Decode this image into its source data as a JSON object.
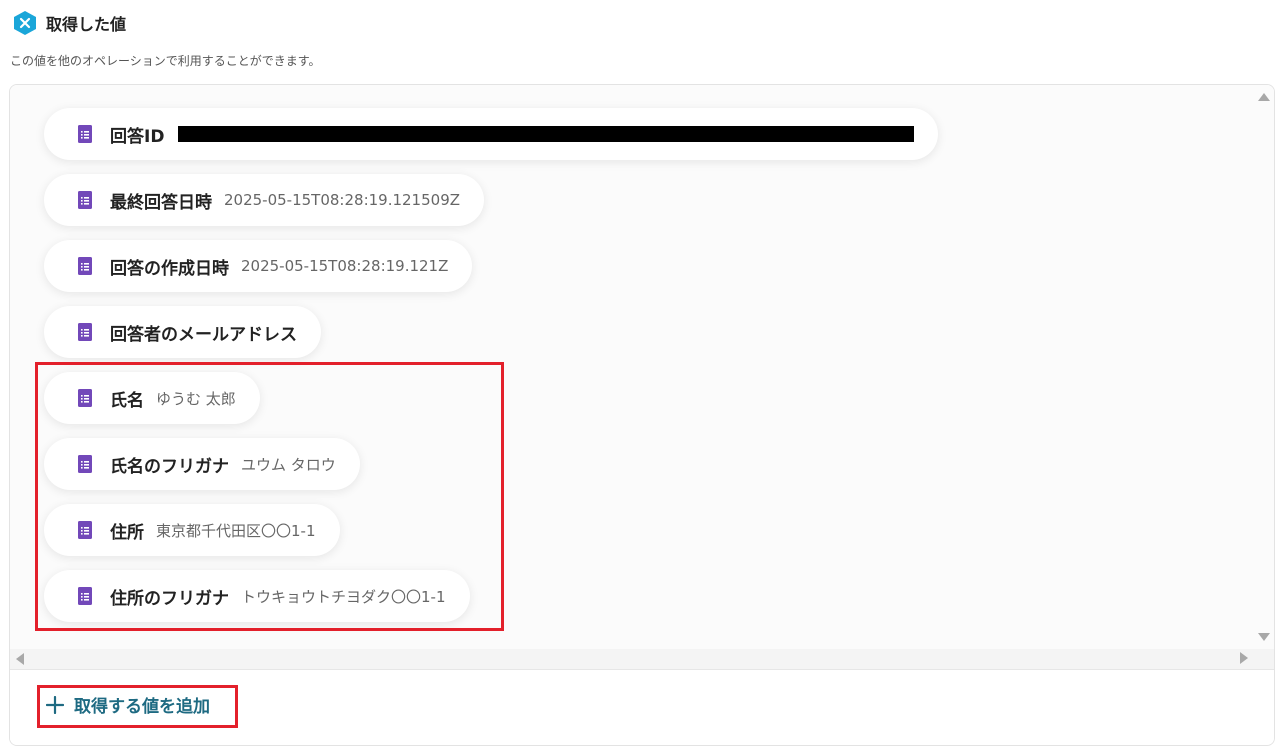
{
  "header": {
    "title": "取得した値",
    "badge_color": "#1aa6d9"
  },
  "description": "この値を他のオペレーションで利用することができます。",
  "fields": [
    {
      "label": "回答ID",
      "value": "",
      "redacted": true
    },
    {
      "label": "最終回答日時",
      "value": "2025-05-15T08:28:19.121509Z"
    },
    {
      "label": "回答の作成日時",
      "value": "2025-05-15T08:28:19.121Z"
    },
    {
      "label": "回答者のメールアドレス",
      "value": ""
    },
    {
      "label": "氏名",
      "value": "ゆうむ 太郎"
    },
    {
      "label": "氏名のフリガナ",
      "value": "ユウム タロウ"
    },
    {
      "label": "住所",
      "value": "東京都千代田区〇〇1-1"
    },
    {
      "label": "住所のフリガナ",
      "value": "トウキョウトチヨダク〇〇1-1"
    }
  ],
  "add_button": {
    "label": "取得する値を追加"
  },
  "colors": {
    "form_icon": "#7248b9",
    "highlight": "#e3202b",
    "accent_text": "#1e6a82"
  }
}
